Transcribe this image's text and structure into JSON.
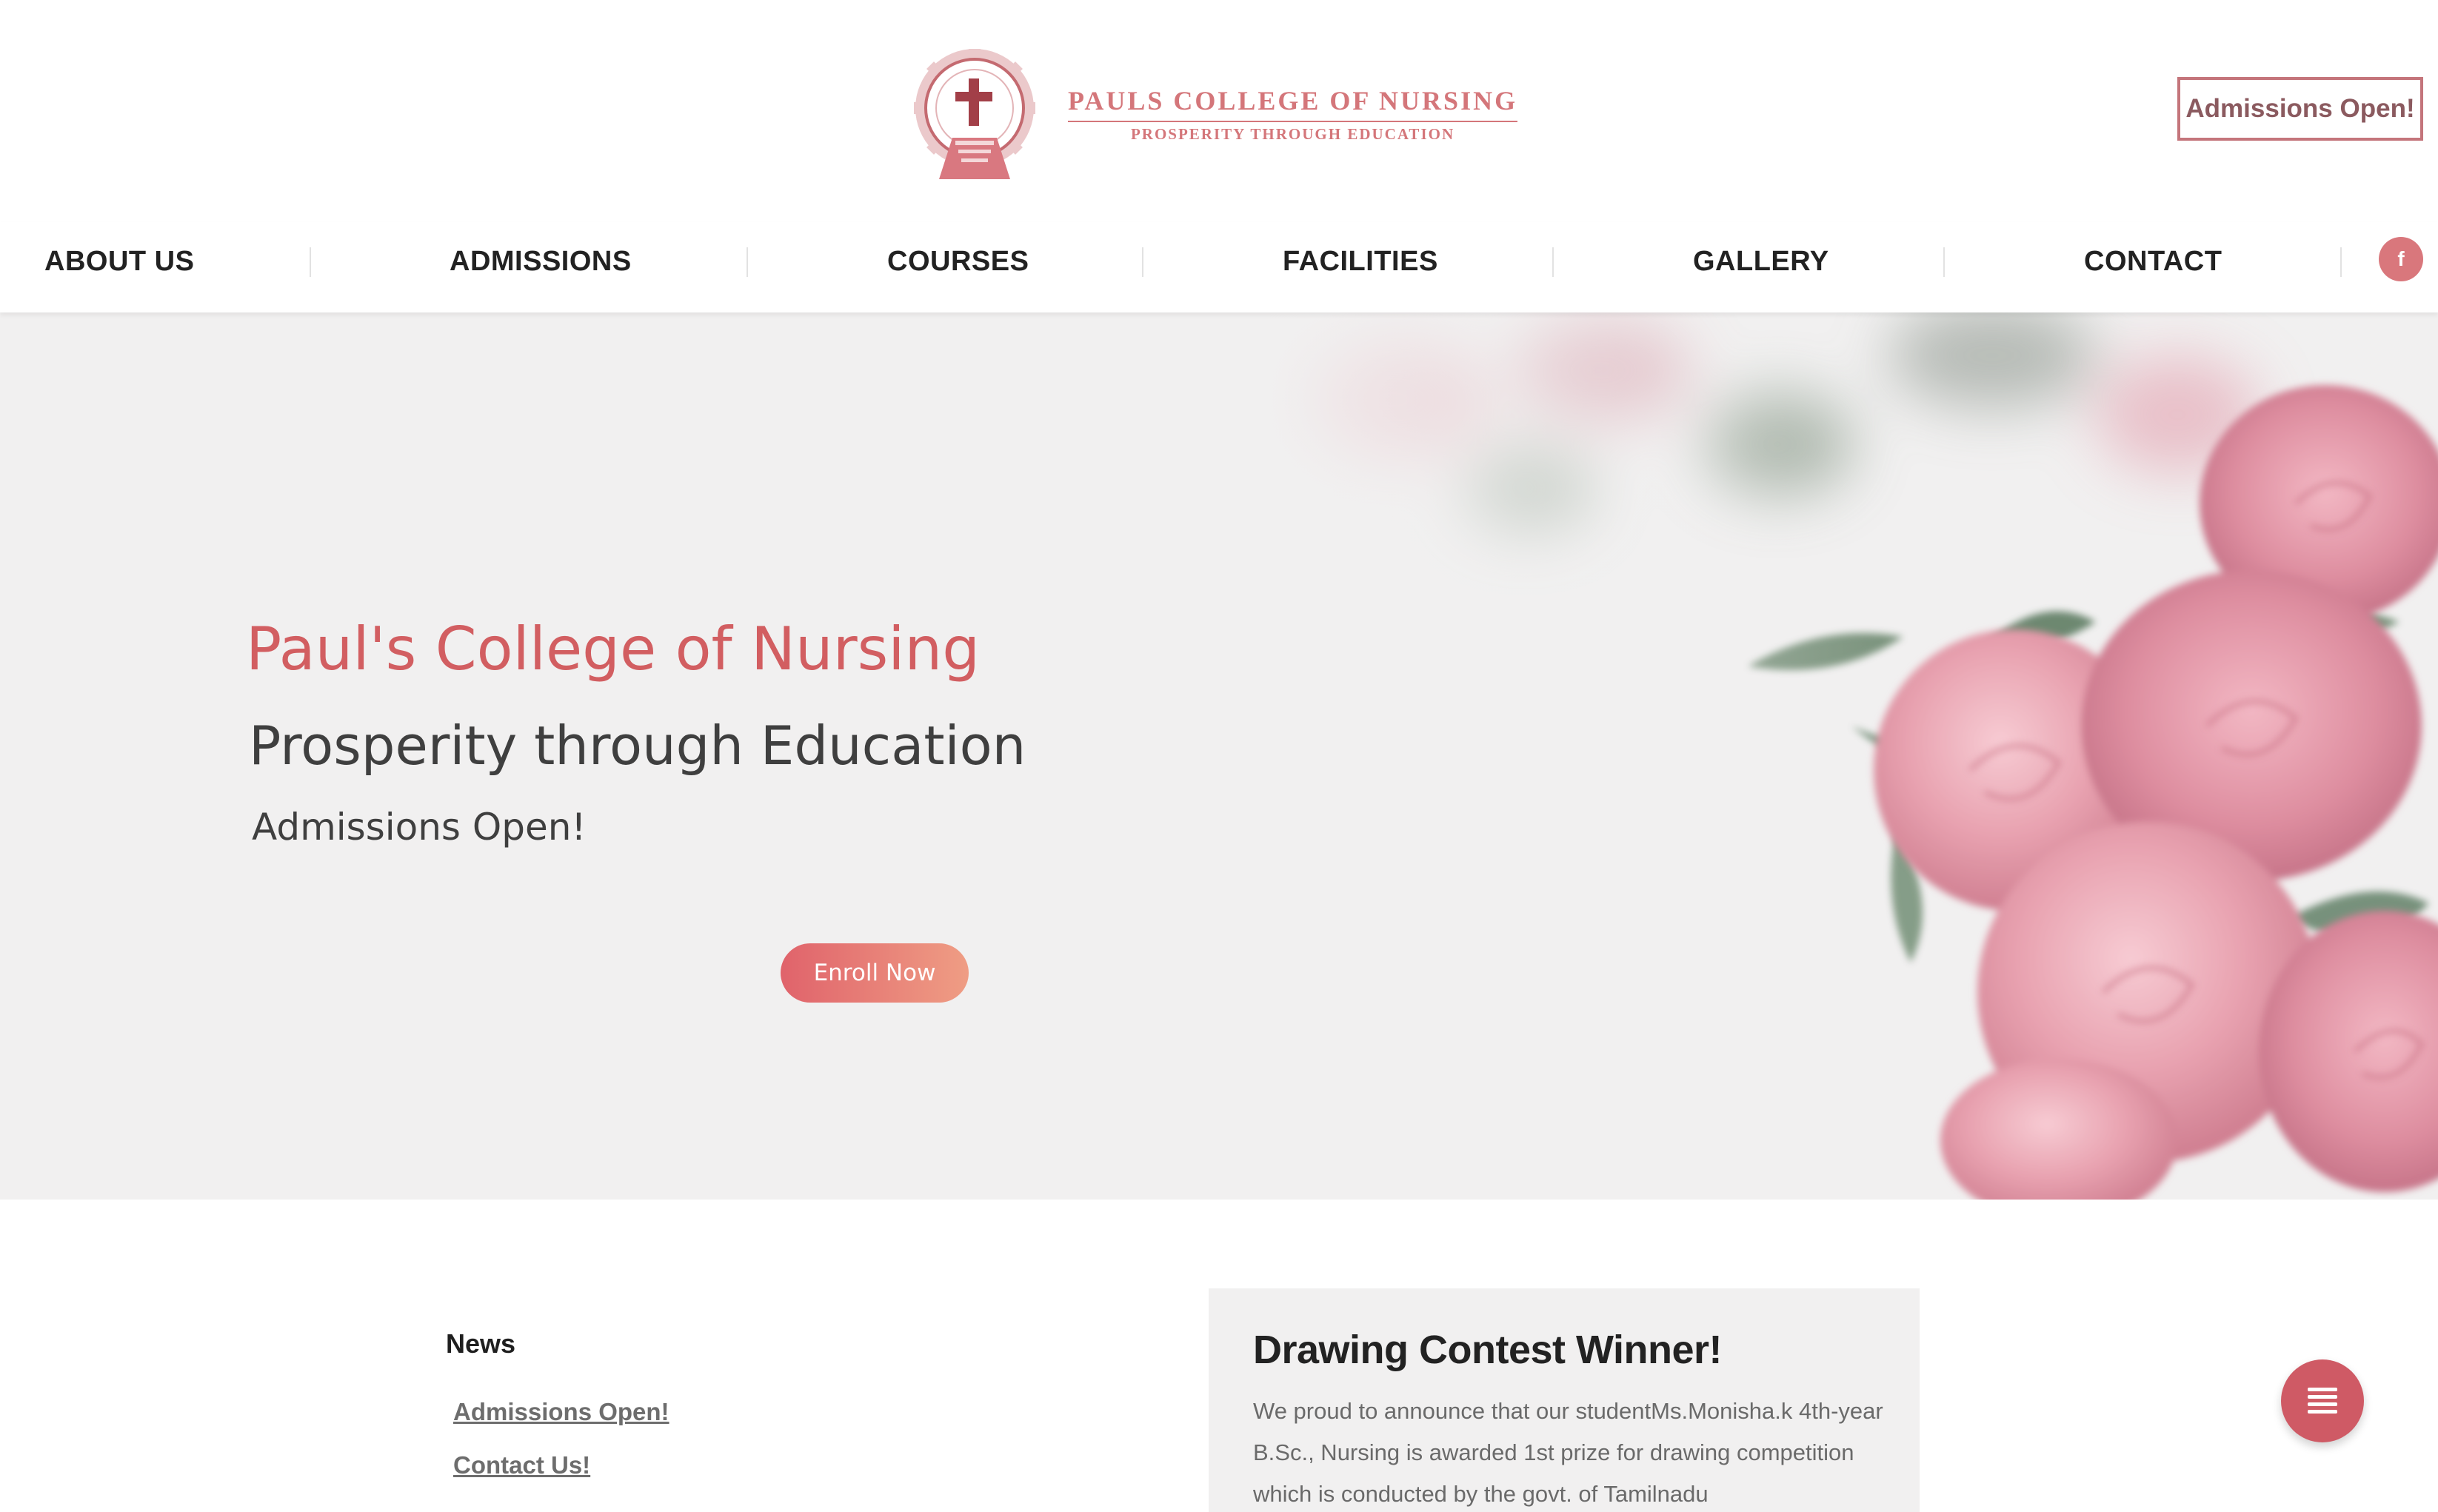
{
  "header": {
    "logo_title": "PAULS COLLEGE OF NURSING",
    "logo_subtitle": "PROSPERITY THROUGH EDUCATION",
    "cta_label": "Admissions Open!",
    "brand_color": "#d4767a"
  },
  "nav": {
    "items": [
      {
        "label": "ABOUT US"
      },
      {
        "label": "ADMISSIONS"
      },
      {
        "label": "COURSES"
      },
      {
        "label": "FACILITIES"
      },
      {
        "label": "GALLERY"
      },
      {
        "label": "CONTACT"
      }
    ],
    "facebook_glyph": "f",
    "facebook_icon": "facebook-icon"
  },
  "hero": {
    "title": "Paul's College of Nursing",
    "subtitle": "Prosperity through Education",
    "admissions_text": "Admissions Open!",
    "button_label": "Enroll Now",
    "title_color": "#d25e61",
    "button_gradient": [
      "#e0636b",
      "#ef9d84"
    ]
  },
  "news": {
    "heading": "News",
    "links": [
      {
        "label": "Admissions Open!"
      },
      {
        "label": "Contact Us!"
      }
    ]
  },
  "card": {
    "title": "Drawing Contest Winner!",
    "body": "We proud to announce that our studentMs.Monisha.k 4th-year B.Sc., Nursing is awarded 1st prize for drawing competition which is conducted by the govt. of Tamilnadu"
  },
  "fab": {
    "icon": "menu-icon",
    "color": "#cf5a65"
  }
}
